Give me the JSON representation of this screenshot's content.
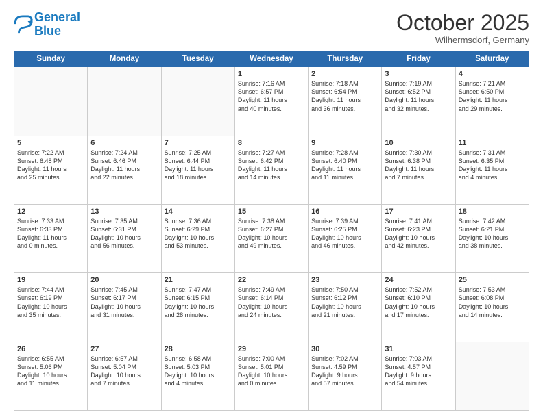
{
  "header": {
    "logo_line1": "General",
    "logo_line2": "Blue",
    "month": "October 2025",
    "location": "Wilhermsdorf, Germany"
  },
  "weekdays": [
    "Sunday",
    "Monday",
    "Tuesday",
    "Wednesday",
    "Thursday",
    "Friday",
    "Saturday"
  ],
  "weeks": [
    [
      {
        "day": "",
        "info": ""
      },
      {
        "day": "",
        "info": ""
      },
      {
        "day": "",
        "info": ""
      },
      {
        "day": "1",
        "info": "Sunrise: 7:16 AM\nSunset: 6:57 PM\nDaylight: 11 hours\nand 40 minutes."
      },
      {
        "day": "2",
        "info": "Sunrise: 7:18 AM\nSunset: 6:54 PM\nDaylight: 11 hours\nand 36 minutes."
      },
      {
        "day": "3",
        "info": "Sunrise: 7:19 AM\nSunset: 6:52 PM\nDaylight: 11 hours\nand 32 minutes."
      },
      {
        "day": "4",
        "info": "Sunrise: 7:21 AM\nSunset: 6:50 PM\nDaylight: 11 hours\nand 29 minutes."
      }
    ],
    [
      {
        "day": "5",
        "info": "Sunrise: 7:22 AM\nSunset: 6:48 PM\nDaylight: 11 hours\nand 25 minutes."
      },
      {
        "day": "6",
        "info": "Sunrise: 7:24 AM\nSunset: 6:46 PM\nDaylight: 11 hours\nand 22 minutes."
      },
      {
        "day": "7",
        "info": "Sunrise: 7:25 AM\nSunset: 6:44 PM\nDaylight: 11 hours\nand 18 minutes."
      },
      {
        "day": "8",
        "info": "Sunrise: 7:27 AM\nSunset: 6:42 PM\nDaylight: 11 hours\nand 14 minutes."
      },
      {
        "day": "9",
        "info": "Sunrise: 7:28 AM\nSunset: 6:40 PM\nDaylight: 11 hours\nand 11 minutes."
      },
      {
        "day": "10",
        "info": "Sunrise: 7:30 AM\nSunset: 6:38 PM\nDaylight: 11 hours\nand 7 minutes."
      },
      {
        "day": "11",
        "info": "Sunrise: 7:31 AM\nSunset: 6:35 PM\nDaylight: 11 hours\nand 4 minutes."
      }
    ],
    [
      {
        "day": "12",
        "info": "Sunrise: 7:33 AM\nSunset: 6:33 PM\nDaylight: 11 hours\nand 0 minutes."
      },
      {
        "day": "13",
        "info": "Sunrise: 7:35 AM\nSunset: 6:31 PM\nDaylight: 10 hours\nand 56 minutes."
      },
      {
        "day": "14",
        "info": "Sunrise: 7:36 AM\nSunset: 6:29 PM\nDaylight: 10 hours\nand 53 minutes."
      },
      {
        "day": "15",
        "info": "Sunrise: 7:38 AM\nSunset: 6:27 PM\nDaylight: 10 hours\nand 49 minutes."
      },
      {
        "day": "16",
        "info": "Sunrise: 7:39 AM\nSunset: 6:25 PM\nDaylight: 10 hours\nand 46 minutes."
      },
      {
        "day": "17",
        "info": "Sunrise: 7:41 AM\nSunset: 6:23 PM\nDaylight: 10 hours\nand 42 minutes."
      },
      {
        "day": "18",
        "info": "Sunrise: 7:42 AM\nSunset: 6:21 PM\nDaylight: 10 hours\nand 38 minutes."
      }
    ],
    [
      {
        "day": "19",
        "info": "Sunrise: 7:44 AM\nSunset: 6:19 PM\nDaylight: 10 hours\nand 35 minutes."
      },
      {
        "day": "20",
        "info": "Sunrise: 7:45 AM\nSunset: 6:17 PM\nDaylight: 10 hours\nand 31 minutes."
      },
      {
        "day": "21",
        "info": "Sunrise: 7:47 AM\nSunset: 6:15 PM\nDaylight: 10 hours\nand 28 minutes."
      },
      {
        "day": "22",
        "info": "Sunrise: 7:49 AM\nSunset: 6:14 PM\nDaylight: 10 hours\nand 24 minutes."
      },
      {
        "day": "23",
        "info": "Sunrise: 7:50 AM\nSunset: 6:12 PM\nDaylight: 10 hours\nand 21 minutes."
      },
      {
        "day": "24",
        "info": "Sunrise: 7:52 AM\nSunset: 6:10 PM\nDaylight: 10 hours\nand 17 minutes."
      },
      {
        "day": "25",
        "info": "Sunrise: 7:53 AM\nSunset: 6:08 PM\nDaylight: 10 hours\nand 14 minutes."
      }
    ],
    [
      {
        "day": "26",
        "info": "Sunrise: 6:55 AM\nSunset: 5:06 PM\nDaylight: 10 hours\nand 11 minutes."
      },
      {
        "day": "27",
        "info": "Sunrise: 6:57 AM\nSunset: 5:04 PM\nDaylight: 10 hours\nand 7 minutes."
      },
      {
        "day": "28",
        "info": "Sunrise: 6:58 AM\nSunset: 5:03 PM\nDaylight: 10 hours\nand 4 minutes."
      },
      {
        "day": "29",
        "info": "Sunrise: 7:00 AM\nSunset: 5:01 PM\nDaylight: 10 hours\nand 0 minutes."
      },
      {
        "day": "30",
        "info": "Sunrise: 7:02 AM\nSunset: 4:59 PM\nDaylight: 9 hours\nand 57 minutes."
      },
      {
        "day": "31",
        "info": "Sunrise: 7:03 AM\nSunset: 4:57 PM\nDaylight: 9 hours\nand 54 minutes."
      },
      {
        "day": "",
        "info": ""
      }
    ]
  ]
}
